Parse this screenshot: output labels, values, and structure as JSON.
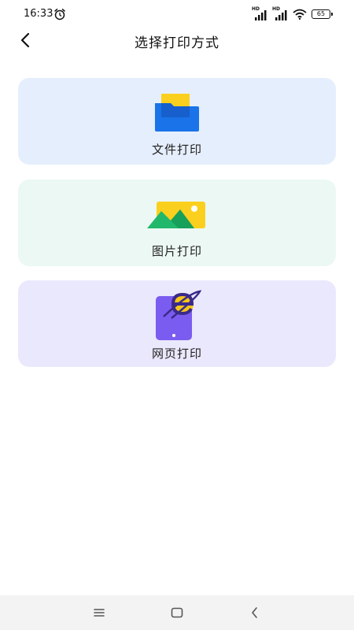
{
  "status_bar": {
    "time": "16:33",
    "signal1_label": "HD",
    "signal2_label": "HD",
    "battery": "65",
    "icons": [
      "alarm-icon",
      "signal-icon",
      "signal-icon",
      "wifi-icon",
      "battery-icon"
    ]
  },
  "header": {
    "title": "选择打印方式",
    "back_icon": "chevron-left-icon"
  },
  "options": [
    {
      "label": "文件打印",
      "icon": "folder-icon",
      "background": "#e5eefc"
    },
    {
      "label": "图片打印",
      "icon": "image-icon",
      "background": "#ebf8f3"
    },
    {
      "label": "网页打印",
      "icon": "web-browser-icon",
      "background": "#eae8fc"
    }
  ],
  "nav_bar": {
    "icons": [
      "menu-icon",
      "home-icon",
      "back-icon"
    ]
  },
  "colors": {
    "folder_blue": "#1a73e8",
    "folder_yellow": "#fbcf1d",
    "image_green": "#21b86b",
    "phone_purple": "#7b5cf0",
    "browser_orange": "#f5c518"
  }
}
